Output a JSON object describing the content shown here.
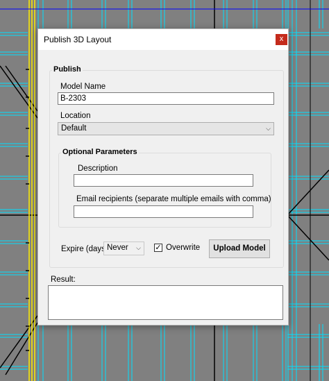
{
  "dialog": {
    "title": "Publish 3D Layout",
    "close_label": "x"
  },
  "publish": {
    "legend": "Publish",
    "model_name_label": "Model Name",
    "model_name_value": "B-2303",
    "location_label": "Location",
    "location_value": "Default"
  },
  "optional": {
    "legend": "Optional Parameters",
    "description_label": "Description",
    "description_value": "",
    "email_label": "Email recipients (separate multiple emails with comma)",
    "email_value": ""
  },
  "expire": {
    "label": "Expire (days)",
    "value": "Never"
  },
  "overwrite": {
    "label": "Overwrite",
    "checked": true,
    "check_glyph": "✓"
  },
  "upload_button": "Upload Model",
  "result": {
    "label": "Result:",
    "value": ""
  },
  "colors": {
    "background": "#808080",
    "cyan_lines": "#00e0ff",
    "yellow_lines": "#ffee00",
    "blue_line": "#0000ff",
    "close_button": "#c42b1c"
  }
}
